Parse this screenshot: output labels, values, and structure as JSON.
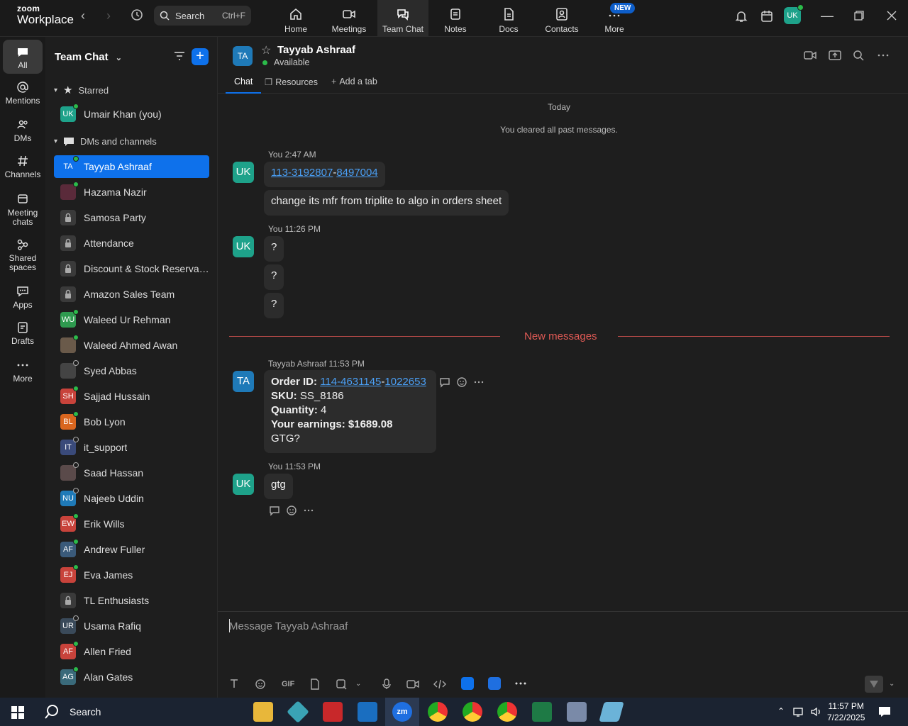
{
  "titlebar": {
    "logo_top": "zoom",
    "logo_bottom": "Workplace",
    "search_label": "Search",
    "search_shortcut": "Ctrl+F",
    "tabs": [
      {
        "label": "Home",
        "icon": "home-icon"
      },
      {
        "label": "Meetings",
        "icon": "video-icon"
      },
      {
        "label": "Team Chat",
        "icon": "chat-icon"
      },
      {
        "label": "Notes",
        "icon": "notes-icon"
      },
      {
        "label": "Docs",
        "icon": "docs-icon"
      },
      {
        "label": "Contacts",
        "icon": "contacts-icon"
      },
      {
        "label": "More",
        "icon": "more-icon"
      }
    ],
    "new_badge": "NEW",
    "user_initials": "UK"
  },
  "rail": [
    {
      "label": "All"
    },
    {
      "label": "Mentions"
    },
    {
      "label": "DMs"
    },
    {
      "label": "Channels"
    },
    {
      "label": "Meeting chats"
    },
    {
      "label": "Shared spaces"
    },
    {
      "label": "Apps"
    },
    {
      "label": "Drafts"
    },
    {
      "label": "More"
    }
  ],
  "sidebar": {
    "title": "Team Chat",
    "starred_label": "Starred",
    "dms_label": "DMs and channels",
    "starred": [
      {
        "initials": "UK",
        "name": "Umair Khan (you)",
        "color": "#1ea28a",
        "status": "online"
      }
    ],
    "items": [
      {
        "initials": "TA",
        "name": "Tayyab Ashraaf",
        "color": "#1f7ab8",
        "status": "online",
        "selected": true
      },
      {
        "initials": "",
        "name": "Hazama Nazir",
        "color": "#5a2a3a",
        "status": "online"
      },
      {
        "initials": "",
        "name": "Samosa Party",
        "color": "#3a3a3a",
        "status": "lock"
      },
      {
        "initials": "",
        "name": "Attendance",
        "color": "#3a3a3a",
        "status": "lock"
      },
      {
        "initials": "",
        "name": "Discount & Stock Reservati...",
        "color": "#3a3a3a",
        "status": "lock"
      },
      {
        "initials": "",
        "name": "Amazon Sales Team",
        "color": "#3a3a3a",
        "status": "lock"
      },
      {
        "initials": "WU",
        "name": "Waleed Ur Rehman",
        "color": "#2e9a4f",
        "status": "online"
      },
      {
        "initials": "",
        "name": "Waleed Ahmed Awan",
        "color": "#6a5a4a",
        "status": "online"
      },
      {
        "initials": "",
        "name": "Syed Abbas",
        "color": "#444",
        "status": "offline"
      },
      {
        "initials": "SH",
        "name": "Sajjad Hussain",
        "color": "#c8433b",
        "status": "online"
      },
      {
        "initials": "BL",
        "name": "Bob Lyon",
        "color": "#d9661f",
        "status": "online"
      },
      {
        "initials": "IT",
        "name": "it_support",
        "color": "#3a4a7a",
        "status": "offline"
      },
      {
        "initials": "",
        "name": "Saad Hassan",
        "color": "#5a4a4a",
        "status": "offline"
      },
      {
        "initials": "NU",
        "name": "Najeeb Uddin",
        "color": "#1f7ab8",
        "status": "offline"
      },
      {
        "initials": "EW",
        "name": "Erik Wills",
        "color": "#c8433b",
        "status": "online"
      },
      {
        "initials": "AF",
        "name": "Andrew Fuller",
        "color": "#3a5a7a",
        "status": "online"
      },
      {
        "initials": "EJ",
        "name": "Eva James",
        "color": "#c8433b",
        "status": "online"
      },
      {
        "initials": "",
        "name": "TL Enthusiasts",
        "color": "#3a3a3a",
        "status": "lock"
      },
      {
        "initials": "UR",
        "name": "Usama Rafiq",
        "color": "#3a4a5a",
        "status": "offline"
      },
      {
        "initials": "AF",
        "name": "Allen Fried",
        "color": "#c8433b",
        "status": "online"
      },
      {
        "initials": "AG",
        "name": "Alan Gates",
        "color": "#3a6a7a",
        "status": "online"
      }
    ]
  },
  "chat": {
    "contact_initials": "TA",
    "contact_name": "Tayyab Ashraaf",
    "contact_status": "Available",
    "tabs": [
      "Chat",
      "Resources",
      "Add a tab"
    ],
    "day_label": "Today",
    "cleared_note": "You cleared all past messages.",
    "new_messages_label": "New messages",
    "groups": [
      {
        "initials": "UK",
        "meta": "You 2:47 AM",
        "link_parts": [
          "113-3192807",
          "-",
          "8497004"
        ],
        "text2": "change its mfr from triplite to algo in orders sheet"
      },
      {
        "initials": "UK",
        "meta": "You 11:26 PM",
        "texts": [
          "?",
          "?",
          "?"
        ]
      },
      {
        "initials": "TA",
        "meta": "Tayyab Ashraaf 11:53 PM",
        "order_label": "Order ID:",
        "order_link": [
          "114-4631145",
          "-",
          "1022653"
        ],
        "sku_label": "SKU:",
        "sku_value": "SS_8186",
        "qty_label": "Quantity:",
        "qty_value": "4",
        "earn_label": "Your earnings: $1689.08",
        "gtg": "GTG?"
      },
      {
        "initials": "UK",
        "meta": "You 11:53 PM",
        "text": "gtg"
      }
    ],
    "composer_placeholder": "Message Tayyab Ashraaf",
    "gif_label": "GIF"
  },
  "taskbar": {
    "search_label": "Search",
    "time": "11:57 PM",
    "date": "7/22/2025"
  }
}
